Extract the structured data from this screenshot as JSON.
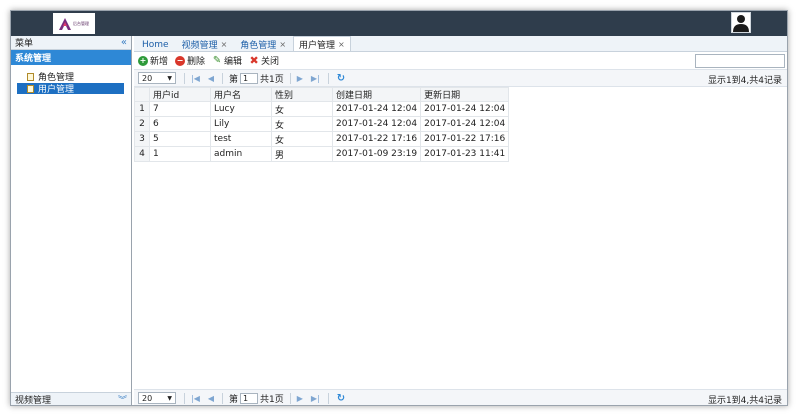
{
  "header": {
    "logo_text": "后台管理"
  },
  "sidebar": {
    "menu_title": "菜单",
    "panel_title": "系统管理",
    "items": [
      {
        "label": "角色管理",
        "active": false
      },
      {
        "label": "用户管理",
        "active": true
      }
    ],
    "footer_title": "视频管理"
  },
  "tabs": [
    {
      "label": "Home",
      "closable": false,
      "active": false
    },
    {
      "label": "视频管理",
      "closable": true,
      "active": false
    },
    {
      "label": "角色管理",
      "closable": true,
      "active": false
    },
    {
      "label": "用户管理",
      "closable": true,
      "active": true
    }
  ],
  "toolbar": {
    "add_label": "新增",
    "delete_label": "删除",
    "edit_label": "编辑",
    "close_label": "关闭",
    "search_value": ""
  },
  "pager": {
    "page_size": "20",
    "page_prefix": "第",
    "current_page": "1",
    "total_pages_text": "共1页",
    "info": "显示1到4,共4记录"
  },
  "table": {
    "columns": [
      "用户id",
      "用户名",
      "性别",
      "创建日期",
      "更新日期"
    ],
    "rows": [
      {
        "num": "1",
        "id": "7",
        "name": "Lucy",
        "sex": "女",
        "created": "2017-01-24 12:04",
        "updated": "2017-01-24 12:04"
      },
      {
        "num": "2",
        "id": "6",
        "name": "Lily",
        "sex": "女",
        "created": "2017-01-24 12:04",
        "updated": "2017-01-24 12:04"
      },
      {
        "num": "3",
        "id": "5",
        "name": "test",
        "sex": "女",
        "created": "2017-01-22 17:16",
        "updated": "2017-01-22 17:16"
      },
      {
        "num": "4",
        "id": "1",
        "name": "admin",
        "sex": "男",
        "created": "2017-01-09 23:19",
        "updated": "2017-01-23 11:41"
      }
    ]
  },
  "colors": {
    "topbar": "#2f3d4c",
    "panel_accent": "#2e88d6",
    "selected_item": "#1d6fc2"
  }
}
